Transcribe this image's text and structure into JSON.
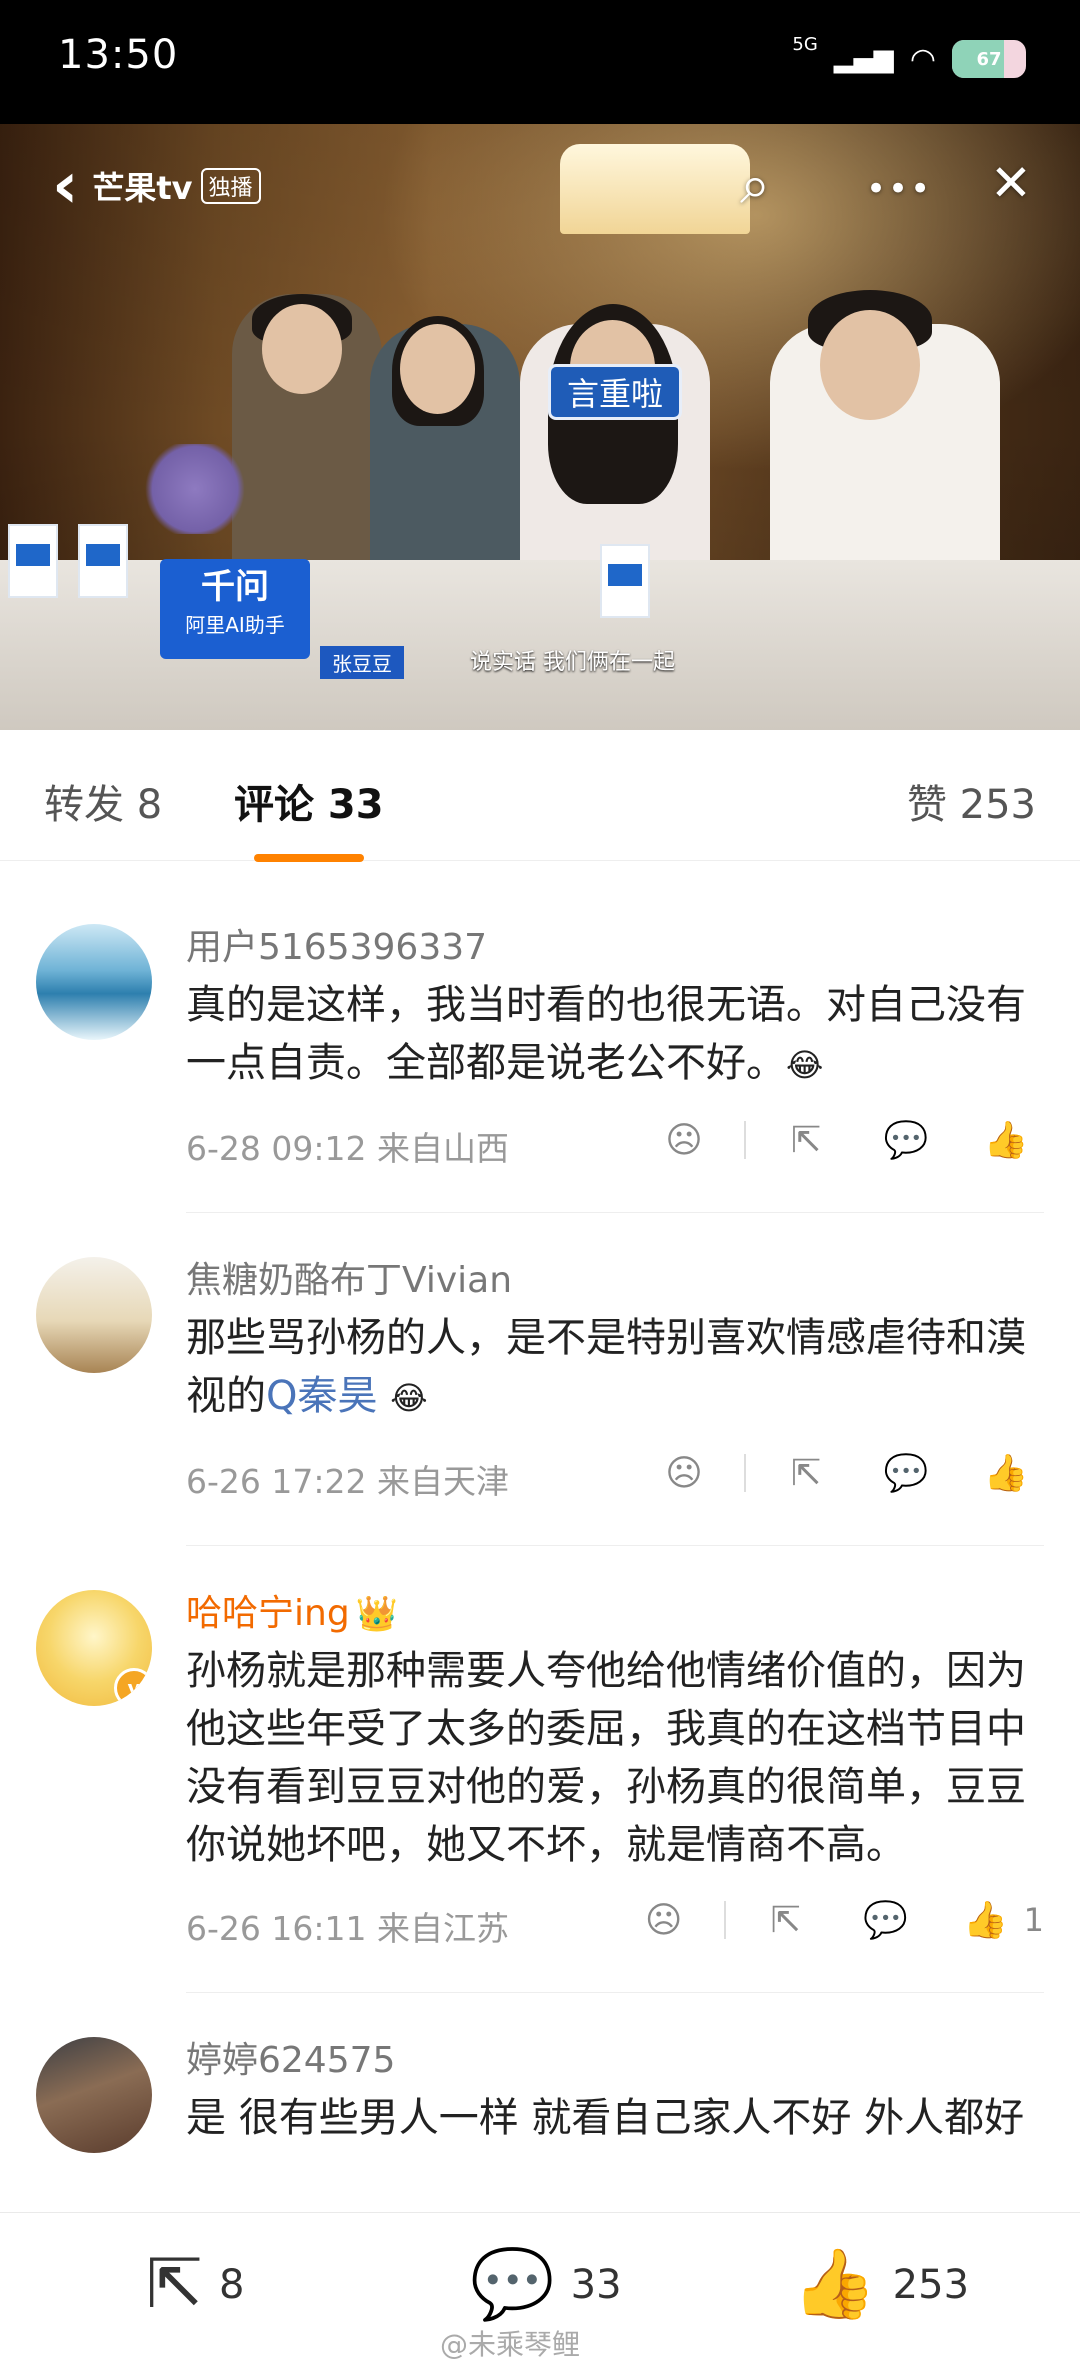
{
  "status_bar": {
    "time": "13:50",
    "network": "5G",
    "battery": "67"
  },
  "video": {
    "logo_text": "芒果tv",
    "logo_badge": "独播",
    "overlay_tag": "言重啦",
    "sign_brand": "千问",
    "sign_sub": "阿里AI助手",
    "name_tag": "张豆豆",
    "caption": "说实话 我们俩在一起",
    "buttons": {
      "back": "‹",
      "search": "⌕",
      "more": "•••",
      "close": "✕",
      "mute": "🔇"
    }
  },
  "tabs": {
    "forward": "转发 8",
    "comments": "评论 33",
    "likes": "赞 253"
  },
  "comments": [
    {
      "user": "用户5165396337",
      "text": "真的是这样，我当时看的也很无语。对自己没有一点自责。全部都是说老公不好。",
      "emoji": "😂",
      "time": "6-28 09:12  来自山西",
      "likes": ""
    },
    {
      "user": "焦糖奶酪布丁Vivian",
      "text": "那些骂孙杨的人，是不是特别喜欢情感虐待和漠视的",
      "link": "Q秦昊",
      "emoji": "😂",
      "time": "6-26 17:22  来自天津",
      "likes": ""
    },
    {
      "user": "哈哈宁ing",
      "crown": "👑",
      "text": "孙杨就是那种需要人夸他给他情绪价值的，因为他这些年受了太多的委屈，我真的在这档节目中没有看到豆豆对他的爱，孙杨真的很简单，豆豆你说她坏吧，她又不坏，就是情商不高。",
      "time": "6-26 16:11  来自江苏",
      "likes": "1"
    },
    {
      "user": "婷婷624575",
      "text": "是 很有些男人一样 就看自己家人不好 外人都好"
    }
  ],
  "bottom_bar": {
    "forward_count": "8",
    "comment_count": "33",
    "like_count": "253",
    "watermark": "@未乘琴鲤"
  },
  "colors": {
    "accent": "#ff8200",
    "link": "#4a74b9",
    "vip_name": "#f26a00"
  }
}
